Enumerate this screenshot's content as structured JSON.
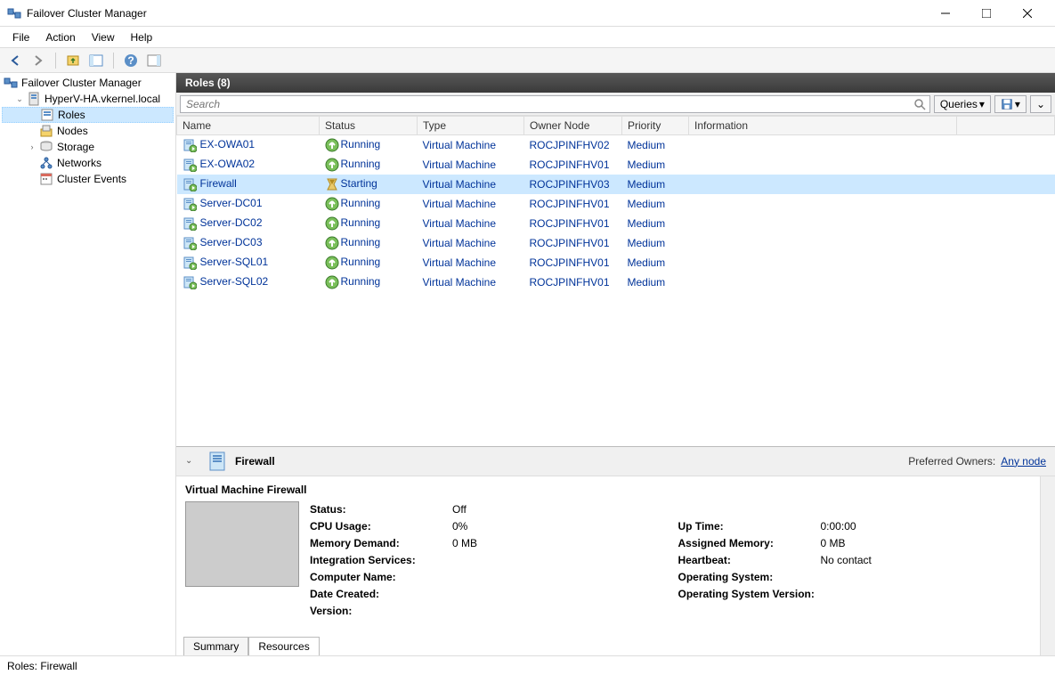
{
  "window": {
    "title": "Failover Cluster Manager"
  },
  "menus": {
    "file": "File",
    "action": "Action",
    "view": "View",
    "help": "Help"
  },
  "tree": {
    "root": "Failover Cluster Manager",
    "cluster": "HyperV-HA.vkernel.local",
    "nodes": {
      "roles": "Roles",
      "nodes": "Nodes",
      "storage": "Storage",
      "networks": "Networks",
      "events": "Cluster Events"
    }
  },
  "header": {
    "title": "Roles (8)"
  },
  "search": {
    "placeholder": "Search",
    "queries": "Queries"
  },
  "columns": {
    "name": "Name",
    "status": "Status",
    "type": "Type",
    "owner": "Owner Node",
    "priority": "Priority",
    "info": "Information"
  },
  "roles": [
    {
      "name": "EX-OWA01",
      "status": "Running",
      "statusKind": "running",
      "type": "Virtual Machine",
      "owner": "ROCJPINFHV02",
      "priority": "Medium",
      "selected": false
    },
    {
      "name": "EX-OWA02",
      "status": "Running",
      "statusKind": "running",
      "type": "Virtual Machine",
      "owner": "ROCJPINFHV01",
      "priority": "Medium",
      "selected": false
    },
    {
      "name": "Firewall",
      "status": "Starting",
      "statusKind": "starting",
      "type": "Virtual Machine",
      "owner": "ROCJPINFHV03",
      "priority": "Medium",
      "selected": true
    },
    {
      "name": "Server-DC01",
      "status": "Running",
      "statusKind": "running",
      "type": "Virtual Machine",
      "owner": "ROCJPINFHV01",
      "priority": "Medium",
      "selected": false
    },
    {
      "name": "Server-DC02",
      "status": "Running",
      "statusKind": "running",
      "type": "Virtual Machine",
      "owner": "ROCJPINFHV01",
      "priority": "Medium",
      "selected": false
    },
    {
      "name": "Server-DC03",
      "status": "Running",
      "statusKind": "running",
      "type": "Virtual Machine",
      "owner": "ROCJPINFHV01",
      "priority": "Medium",
      "selected": false
    },
    {
      "name": "Server-SQL01",
      "status": "Running",
      "statusKind": "running",
      "type": "Virtual Machine",
      "owner": "ROCJPINFHV01",
      "priority": "Medium",
      "selected": false
    },
    {
      "name": "Server-SQL02",
      "status": "Running",
      "statusKind": "running",
      "type": "Virtual Machine",
      "owner": "ROCJPINFHV01",
      "priority": "Medium",
      "selected": false
    }
  ],
  "detail": {
    "title": "Firewall",
    "preferred_owners_label": "Preferred Owners:",
    "preferred_owners_link": "Any node",
    "section": "Virtual Machine Firewall",
    "labels": {
      "status": "Status:",
      "cpu": "CPU Usage:",
      "mem": "Memory Demand:",
      "integ": "Integration Services:",
      "comp": "Computer Name:",
      "created": "Date Created:",
      "version": "Version:",
      "uptime": "Up Time:",
      "assigned": "Assigned Memory:",
      "heartbeat": "Heartbeat:",
      "os": "Operating System:",
      "osver": "Operating System Version:"
    },
    "values": {
      "status": "Off",
      "cpu": "0%",
      "mem": "0 MB",
      "integ": "",
      "comp": "",
      "created": "",
      "version": "",
      "uptime": "0:00:00",
      "assigned": "0 MB",
      "heartbeat": "No contact",
      "os": "",
      "osver": ""
    },
    "tabs": {
      "summary": "Summary",
      "resources": "Resources"
    }
  },
  "statusbar": {
    "text": "Roles: Firewall"
  }
}
